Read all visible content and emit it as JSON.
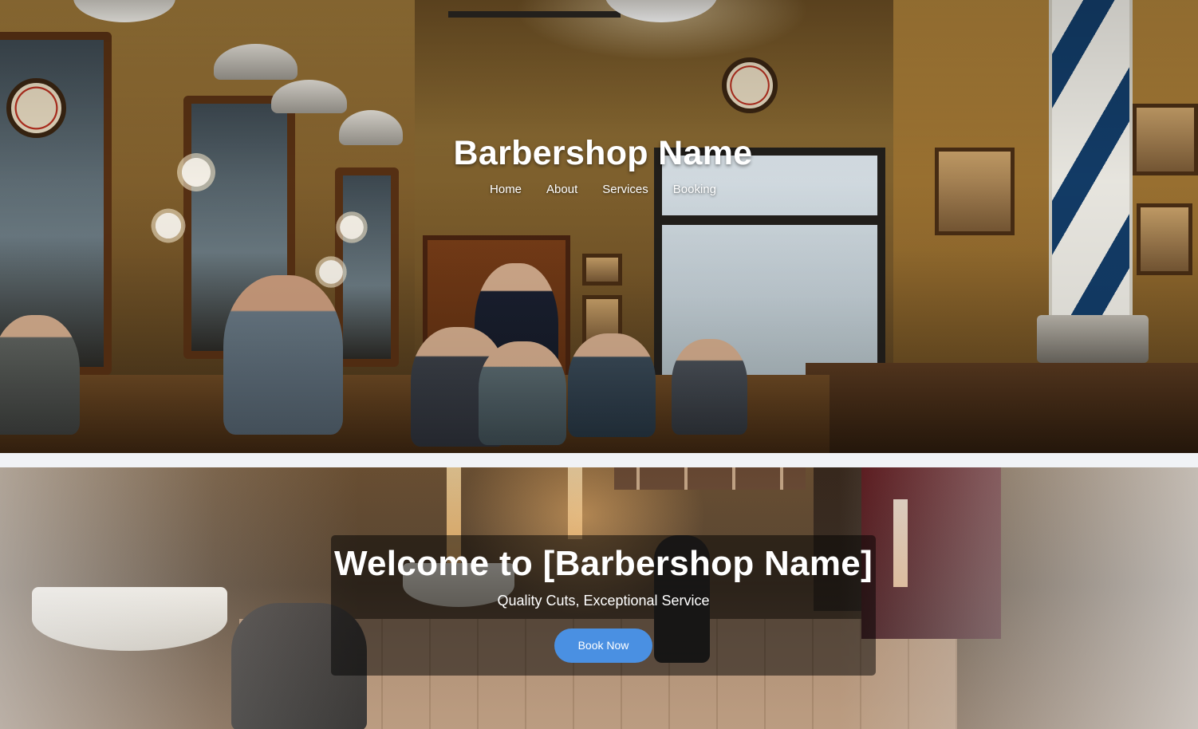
{
  "header": {
    "site_title": "Barbershop Name",
    "nav": [
      {
        "label": "Home"
      },
      {
        "label": "About"
      },
      {
        "label": "Services"
      },
      {
        "label": "Booking"
      }
    ]
  },
  "hero": {
    "title": "Welcome to [Barbershop Name]",
    "subtitle": "Quality Cuts, Exceptional Service",
    "cta_label": "Book Now"
  },
  "colors": {
    "page_background": "#f1f3f6",
    "cta_button": "#4a90e2",
    "text_light": "#ffffff",
    "overlay": "rgba(0,0,0,0.5)"
  }
}
